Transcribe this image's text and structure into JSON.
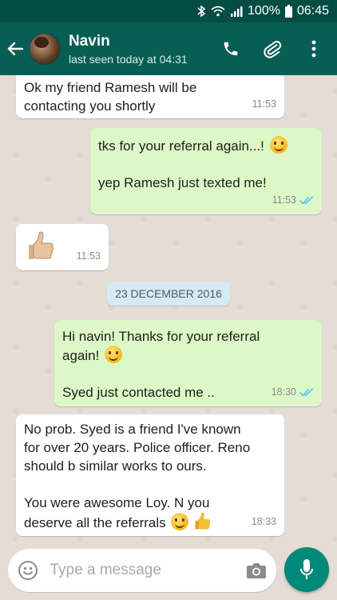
{
  "status_bar": {
    "battery": "100%",
    "time": "06:45"
  },
  "header": {
    "contact_name": "Navin",
    "last_seen": "last seen today at 04:31"
  },
  "messages": [
    {
      "direction": "in",
      "text": "Ok my friend Ramesh will be\ncontacting you shortly",
      "time": "11:53"
    },
    {
      "direction": "out",
      "text_line1": "tks for your referral again...!",
      "text_line2": "yep Ramesh just texted me!",
      "time": "11:53",
      "status": "read"
    },
    {
      "direction": "in",
      "emoji": "thumbs-up",
      "time": "11:53"
    },
    {
      "direction": "out",
      "text_line1": "Hi navin! Thanks for your referral",
      "text_line2": "again!",
      "text_line3": "Syed just contacted me ..",
      "time": "18:30",
      "status": "read"
    },
    {
      "direction": "in",
      "text": "No prob. Syed is a friend I've known\nfor over 20 years. Police officer. Reno\nshould b similar works to ours.\n\nYou were awesome Loy. N you",
      "text_last": "deserve all the referrals",
      "time": "18:33"
    }
  ],
  "date_separator": "23 DECEMBER 2016",
  "composer": {
    "placeholder": "Type a message"
  },
  "colors": {
    "header": "#075e54",
    "status_bar": "#054d44",
    "outgoing_bubble": "#dcf8c6",
    "incoming_bubble": "#ffffff",
    "read_ticks": "#4fc3f7",
    "mic_button": "#00897b"
  }
}
